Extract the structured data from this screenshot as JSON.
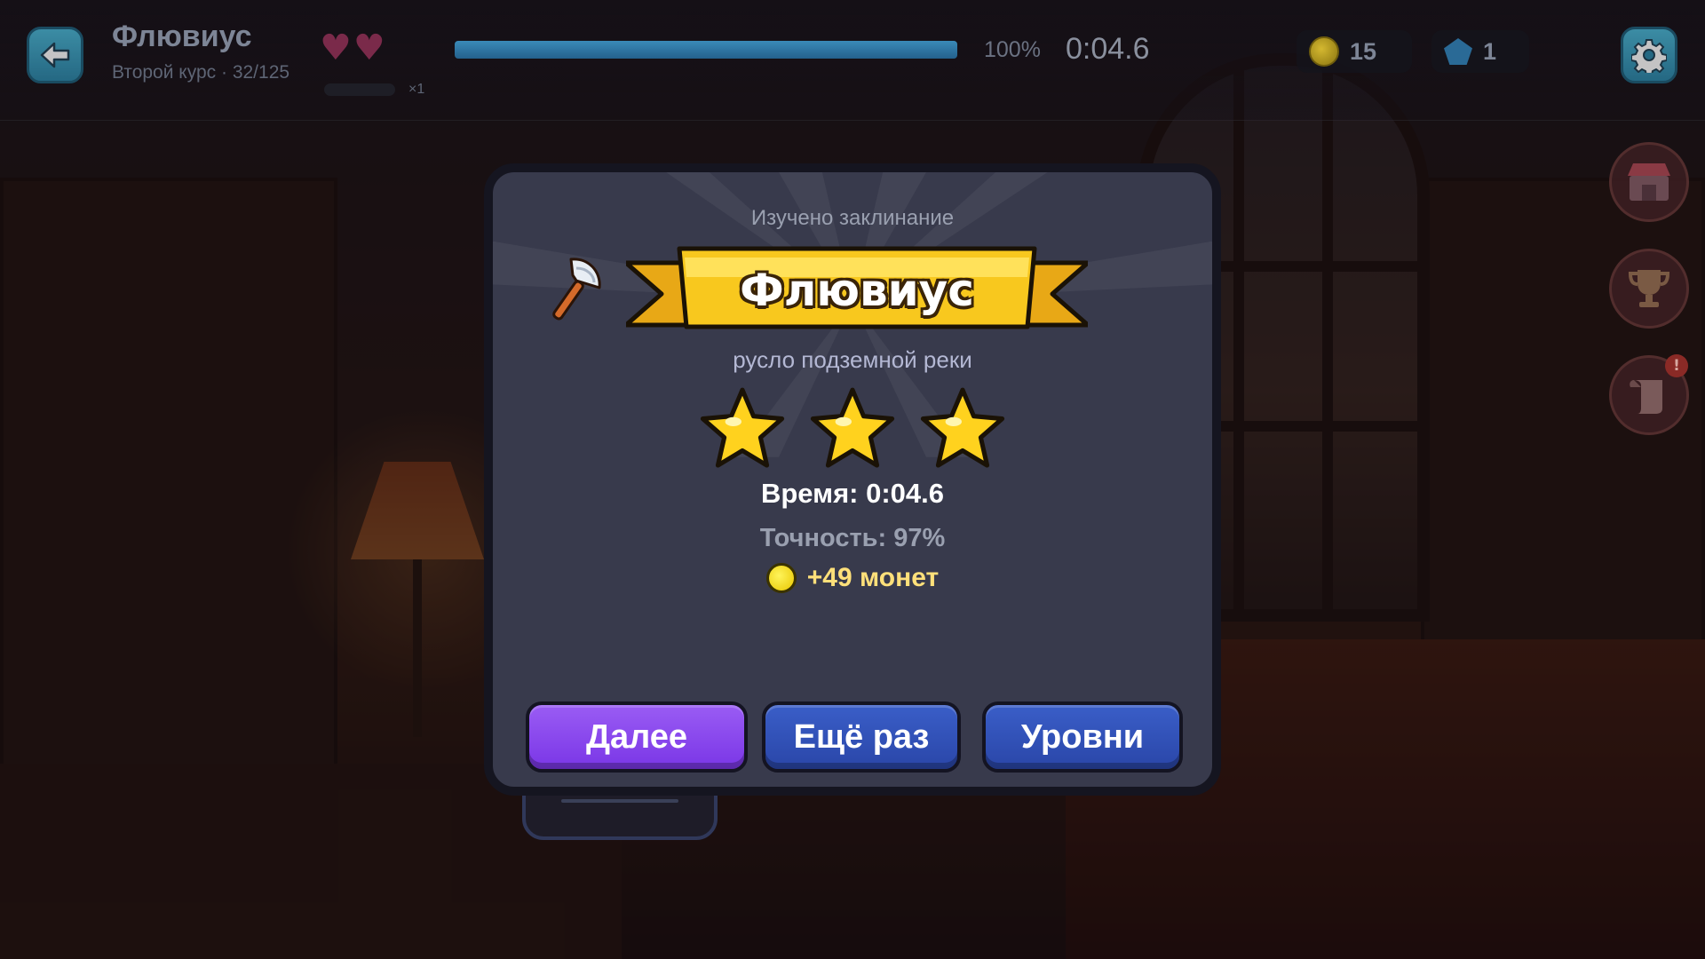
{
  "hud": {
    "title": "Флювиус",
    "subtitle": "Второй курс · 32/125",
    "lives": 2,
    "combo": "×1",
    "progress_percent": 100,
    "progress_label": "100%",
    "timer": "0:04.6",
    "coins": "15",
    "gems": "1",
    "icons": {
      "back": "back-arrow-icon",
      "settings": "gear-icon",
      "shop": "shop-icon",
      "trophy": "trophy-icon",
      "scroll": "scroll-icon"
    },
    "scroll_badge": "!"
  },
  "modal": {
    "caption": "Изучено заклинание",
    "spell_name": "Флювиус",
    "spell_icon": "axe-icon",
    "meaning": "русло подземной реки",
    "stars_earned": 3,
    "stars_total": 3,
    "time_text": "Время: 0:04.6",
    "accuracy_text": "Точность: 97%",
    "reward_text": "+49 монет",
    "buttons": {
      "next": "Далее",
      "retry": "Ещё раз",
      "levels": "Уровни"
    }
  },
  "colors": {
    "accent_purple": "#8a4af0",
    "button_blue": "#2f50b8",
    "ribbon_gold": "#f6c41c",
    "star_gold": "#ffd21e",
    "modal_bg": "#383a4c"
  }
}
